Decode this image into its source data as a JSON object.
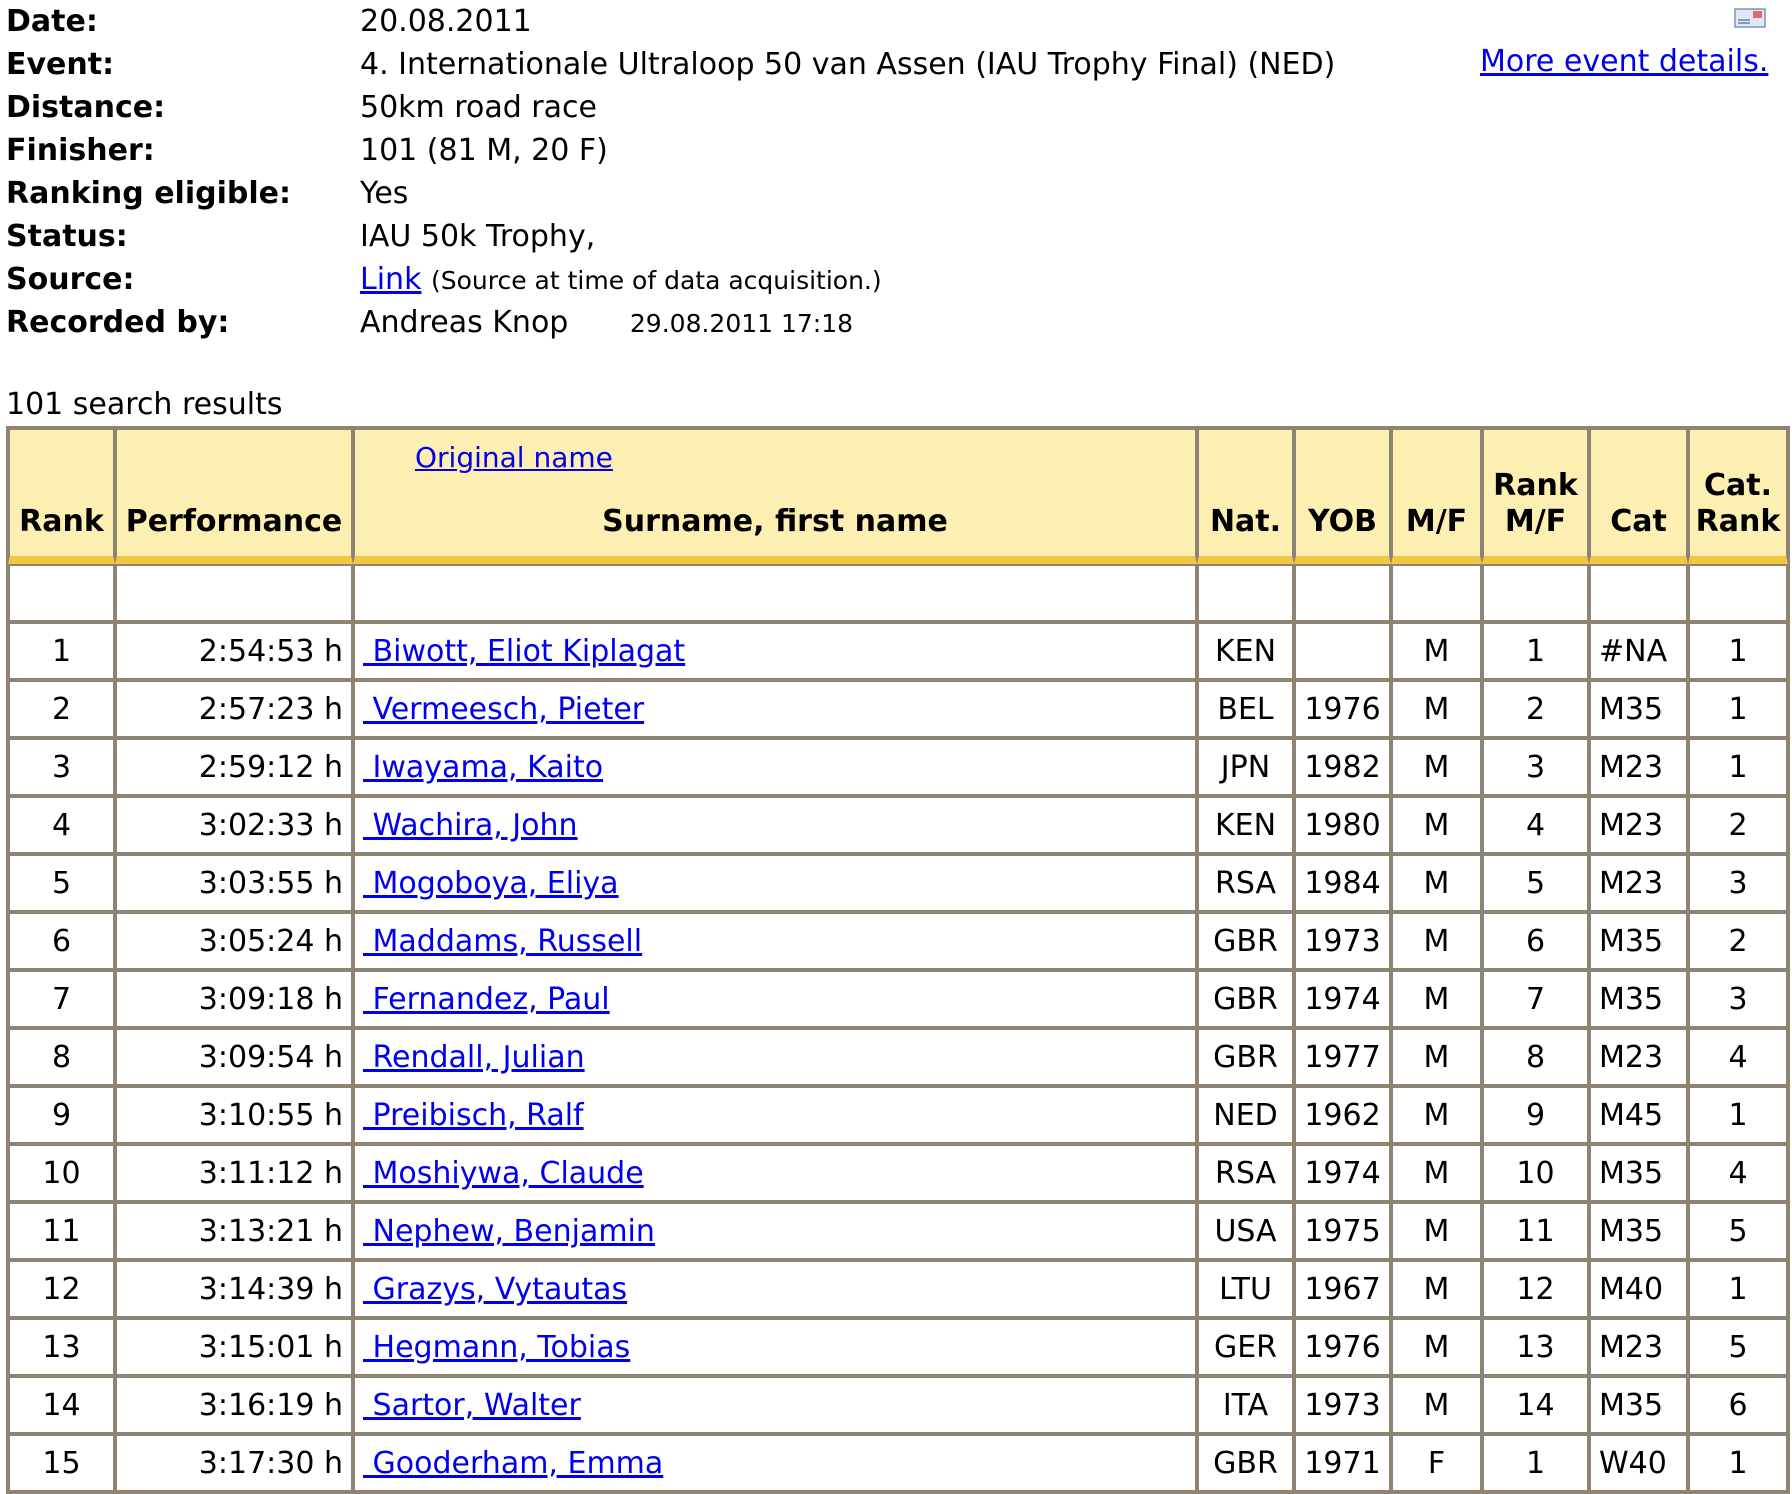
{
  "info": [
    {
      "label": "Date:",
      "value": "20.08.2011"
    },
    {
      "label": "Event:",
      "value": "4. Internationale Ultraloop 50 van Assen (IAU Trophy Final) (NED)"
    },
    {
      "label": "Distance:",
      "value": "50km road race"
    },
    {
      "label": "Finisher:",
      "value": "101 (81 M, 20 F)"
    },
    {
      "label": "Ranking eligible:",
      "value": "Yes"
    },
    {
      "label": "Status:",
      "value": "IAU 50k Trophy,"
    }
  ],
  "source": {
    "label": "Source:",
    "link_text": "Link",
    "note": "(Source at time of data acquisition.)"
  },
  "recorded": {
    "label": "Recorded by:",
    "name": "Andreas Knop",
    "date": "29.08.2011 17:18"
  },
  "more_details_link": "More event details.",
  "result_count": "101 search results",
  "table": {
    "headers": {
      "rank": "Rank",
      "performance": "Performance",
      "original_name": "Original name",
      "name": "Surname, first name",
      "nat": "Nat.",
      "yob": "YOB",
      "mf": "M/F",
      "rank_mf_1": "Rank",
      "rank_mf_2": "M/F",
      "cat": "Cat",
      "cat_rank_1": "Cat.",
      "cat_rank_2": "Rank"
    },
    "rows": [
      {
        "rank": "1",
        "performance": "2:54:53 h",
        "name": "Biwott, Eliot Kiplagat",
        "nat": "KEN",
        "yob": "",
        "mf": "M",
        "rank_mf": "1",
        "cat": "#NA",
        "cat_rank": "1"
      },
      {
        "rank": "2",
        "performance": "2:57:23 h",
        "name": "Vermeesch, Pieter",
        "nat": "BEL",
        "yob": "1976",
        "mf": "M",
        "rank_mf": "2",
        "cat": "M35",
        "cat_rank": "1"
      },
      {
        "rank": "3",
        "performance": "2:59:12 h",
        "name": "Iwayama, Kaito",
        "nat": "JPN",
        "yob": "1982",
        "mf": "M",
        "rank_mf": "3",
        "cat": "M23",
        "cat_rank": "1"
      },
      {
        "rank": "4",
        "performance": "3:02:33 h",
        "name": "Wachira, John",
        "nat": "KEN",
        "yob": "1980",
        "mf": "M",
        "rank_mf": "4",
        "cat": "M23",
        "cat_rank": "2"
      },
      {
        "rank": "5",
        "performance": "3:03:55 h",
        "name": "Mogoboya, Eliya",
        "nat": "RSA",
        "yob": "1984",
        "mf": "M",
        "rank_mf": "5",
        "cat": "M23",
        "cat_rank": "3"
      },
      {
        "rank": "6",
        "performance": "3:05:24 h",
        "name": "Maddams, Russell",
        "nat": "GBR",
        "yob": "1973",
        "mf": "M",
        "rank_mf": "6",
        "cat": "M35",
        "cat_rank": "2"
      },
      {
        "rank": "7",
        "performance": "3:09:18 h",
        "name": "Fernandez, Paul",
        "nat": "GBR",
        "yob": "1974",
        "mf": "M",
        "rank_mf": "7",
        "cat": "M35",
        "cat_rank": "3"
      },
      {
        "rank": "8",
        "performance": "3:09:54 h",
        "name": "Rendall, Julian",
        "nat": "GBR",
        "yob": "1977",
        "mf": "M",
        "rank_mf": "8",
        "cat": "M23",
        "cat_rank": "4"
      },
      {
        "rank": "9",
        "performance": "3:10:55 h",
        "name": "Preibisch, Ralf",
        "nat": "NED",
        "yob": "1962",
        "mf": "M",
        "rank_mf": "9",
        "cat": "M45",
        "cat_rank": "1"
      },
      {
        "rank": "10",
        "performance": "3:11:12 h",
        "name": "Moshiywa, Claude",
        "nat": "RSA",
        "yob": "1974",
        "mf": "M",
        "rank_mf": "10",
        "cat": "M35",
        "cat_rank": "4"
      },
      {
        "rank": "11",
        "performance": "3:13:21 h",
        "name": "Nephew, Benjamin",
        "nat": "USA",
        "yob": "1975",
        "mf": "M",
        "rank_mf": "11",
        "cat": "M35",
        "cat_rank": "5"
      },
      {
        "rank": "12",
        "performance": "3:14:39 h",
        "name": "Grazys, Vytautas",
        "nat": "LTU",
        "yob": "1967",
        "mf": "M",
        "rank_mf": "12",
        "cat": "M40",
        "cat_rank": "1"
      },
      {
        "rank": "13",
        "performance": "3:15:01 h",
        "name": "Hegmann, Tobias",
        "nat": "GER",
        "yob": "1976",
        "mf": "M",
        "rank_mf": "13",
        "cat": "M23",
        "cat_rank": "5"
      },
      {
        "rank": "14",
        "performance": "3:16:19 h",
        "name": "Sartor, Walter",
        "nat": "ITA",
        "yob": "1973",
        "mf": "M",
        "rank_mf": "14",
        "cat": "M35",
        "cat_rank": "6"
      },
      {
        "rank": "15",
        "performance": "3:17:30 h",
        "name": "Gooderham, Emma",
        "nat": "GBR",
        "yob": "1971",
        "mf": "F",
        "rank_mf": "1",
        "cat": "W40",
        "cat_rank": "1"
      }
    ]
  },
  "icons": {
    "mail": "mail-icon"
  },
  "colors": {
    "link": "#0000ee",
    "header_bg": "#fdeeb2",
    "header_accent": "#f2c840",
    "border": "#8f8373"
  }
}
